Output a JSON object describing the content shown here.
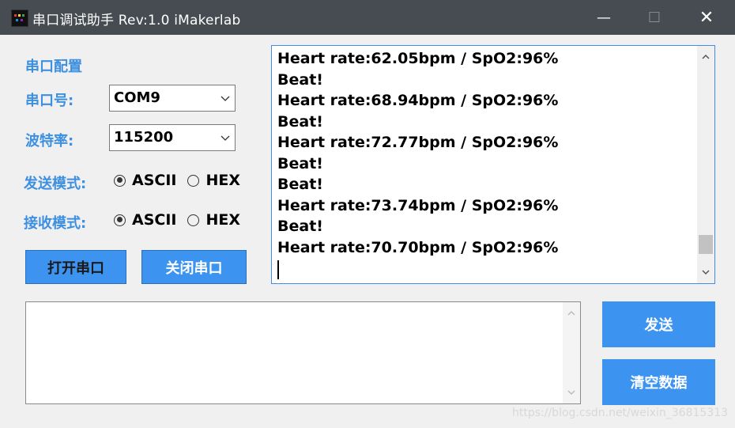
{
  "window": {
    "title": "串口调试助手 Rev:1.0    iMakerlab",
    "controls": {
      "minimize": "—",
      "maximize": "☐",
      "close": "✕"
    }
  },
  "config": {
    "section_title": "串口配置",
    "port_label": "串口号:",
    "port_value": "COM9",
    "baud_label": "波特率:",
    "baud_value": "115200",
    "send_mode_label": "发送模式:",
    "recv_mode_label": "接收模式:",
    "mode_options": [
      "ASCII",
      "HEX"
    ],
    "send_mode_selected": "ASCII",
    "recv_mode_selected": "ASCII"
  },
  "buttons": {
    "open_port": "打开串口",
    "close_port": "关闭串口",
    "send": "发送",
    "clear": "清空数据"
  },
  "receive": {
    "lines": [
      "Heart rate:62.05bpm / SpO2:96%",
      "Beat!",
      "Heart rate:68.94bpm / SpO2:96%",
      "Beat!",
      "Heart rate:72.77bpm / SpO2:96%",
      "Beat!",
      "Beat!",
      "Heart rate:73.74bpm / SpO2:96%",
      "Beat!",
      "Heart rate:70.70bpm / SpO2:96%"
    ],
    "scroll_position": 0.95
  },
  "send_input": {
    "value": ""
  },
  "watermark": "https://blog.csdn.net/weixin_36815313",
  "colors": {
    "accent": "#3d94f0",
    "label": "#3d8fe0",
    "titlebar": "#464c51"
  }
}
